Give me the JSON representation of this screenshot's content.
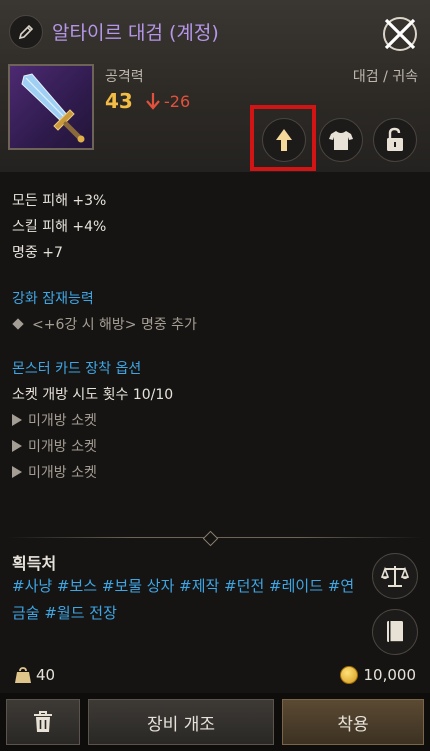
{
  "header": {
    "title": "알타이르 대검 (계정)",
    "stat_label": "공격력",
    "stat_value": "43",
    "stat_diff": "-26",
    "category": "대검 / 귀속"
  },
  "effects": {
    "lines": [
      "모든 피해 +3%",
      "스킬 피해 +4%",
      "명중 +7"
    ]
  },
  "enhance": {
    "title": "강화 잠재능력",
    "item": "<+6강 시 해방> 명중 추가"
  },
  "monster_card": {
    "title": "몬스터 카드 장착 옵션",
    "socket_attempts": "소켓 개방 시도 횟수 10/10",
    "sockets": [
      "미개방 소켓",
      "미개방 소켓",
      "미개방 소켓"
    ]
  },
  "source": {
    "title": "획득처",
    "line1": "#사냥 #보스 #보물 상자 #제작 #던전 #레이드 #연",
    "line2": "금술 #월드 전장"
  },
  "bottom": {
    "weight": "40",
    "gold": "10,000"
  },
  "footer": {
    "modify_label": "장비 개조",
    "equip_label": "착용"
  },
  "colors": {
    "title": "#b596e8",
    "section": "#3fa6e4",
    "stat_value": "#f2bc45",
    "stat_diff": "#e2513c",
    "highlight": "#d21414"
  },
  "icons": [
    "pencil-icon",
    "close-icon",
    "sword-icon",
    "arrow-down-icon",
    "arrow-up-icon",
    "shirt-icon",
    "unlock-icon",
    "scale-icon",
    "book-icon",
    "weight-icon",
    "coin-icon",
    "trash-icon"
  ]
}
